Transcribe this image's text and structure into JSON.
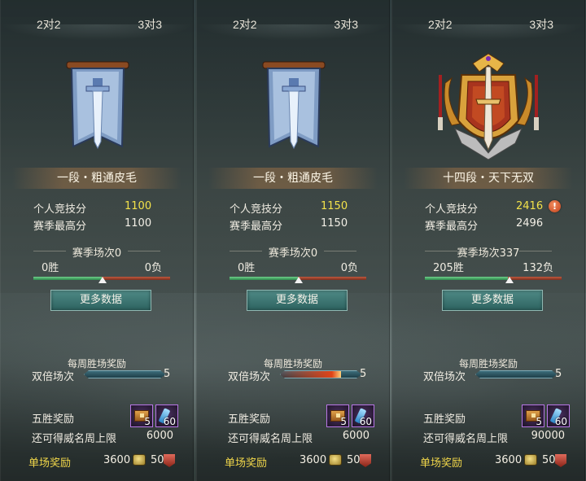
{
  "panels": [
    {
      "tabs": [
        "2对2",
        "3对3"
      ],
      "emblem": "blue-sword-banner",
      "rank": "一段・粗通皮毛",
      "personal_score_label": "个人竞技分",
      "personal_score": "1150",
      "season_high_label": "赛季最高分",
      "season_high": "1150",
      "warning": false,
      "season_matches": "赛季场次0",
      "wins": "0胜",
      "losses": "0负",
      "win_ratio": 0.5,
      "more_data": "更多数据",
      "weekly_reward": "每周胜场奖励",
      "double_label": "双倍场次",
      "double_count": "5",
      "double_progress": 0.75,
      "five_win_reward": "五胜奖励",
      "item1_count": "5",
      "item2_count": "60",
      "prestige_limit_label": "还可得威名周上限",
      "prestige_limit": "6000",
      "single_reward": "单场奖励",
      "coin_reward": "3600",
      "badge_reward": "50"
    },
    {
      "tabs": [
        "2对2",
        "3对3"
      ],
      "emblem": "golden-winged-crest",
      "rank": "十四段・天下无双",
      "personal_score_label": "个人竞技分",
      "personal_score": "2416",
      "season_high_label": "赛季最高分",
      "season_high": "2496",
      "warning": true,
      "warning_glyph": "!",
      "season_matches": "赛季场次337",
      "wins": "205胜",
      "losses": "132负",
      "win_ratio": 0.61,
      "more_data": "更多数据",
      "weekly_reward": "每周胜场奖励",
      "double_label": "双倍场次",
      "double_count": "5",
      "double_progress": 0,
      "five_win_reward": "五胜奖励",
      "item1_count": "5",
      "item2_count": "60",
      "prestige_limit_label": "还可得威名周上限",
      "prestige_limit": "90000",
      "single_reward": "单场奖励",
      "coin_reward": "3600",
      "badge_reward": "50"
    },
    {
      "tabs": [
        "2对2",
        "3对3"
      ],
      "emblem": "blue-sword-banner",
      "rank": "一段・粗通皮毛",
      "personal_score_label": "个人竞技分",
      "personal_score": "1100",
      "season_high_label": "赛季最高分",
      "season_high": "1100",
      "warning": false,
      "season_matches": "赛季场次0",
      "wins": "0胜",
      "losses": "0负",
      "win_ratio": 0.5,
      "more_data": "更多数据",
      "weekly_reward": "每周胜场奖励",
      "double_label": "双倍场次",
      "double_count": "5",
      "double_progress": 0,
      "five_win_reward": "五胜奖励",
      "item1_count": "5",
      "item2_count": "60",
      "prestige_limit_label": "还可得威名周上限",
      "prestige_limit": "6000",
      "single_reward": "单场奖励",
      "coin_reward": "3600",
      "badge_reward": "50"
    }
  ],
  "colors": {
    "score_highlight": "#f3e24a",
    "single_reward_label": "#f0d64a",
    "win_bar": "#2e8a4c",
    "loss_bar": "#7a2f1f",
    "button": "#2d6360"
  }
}
